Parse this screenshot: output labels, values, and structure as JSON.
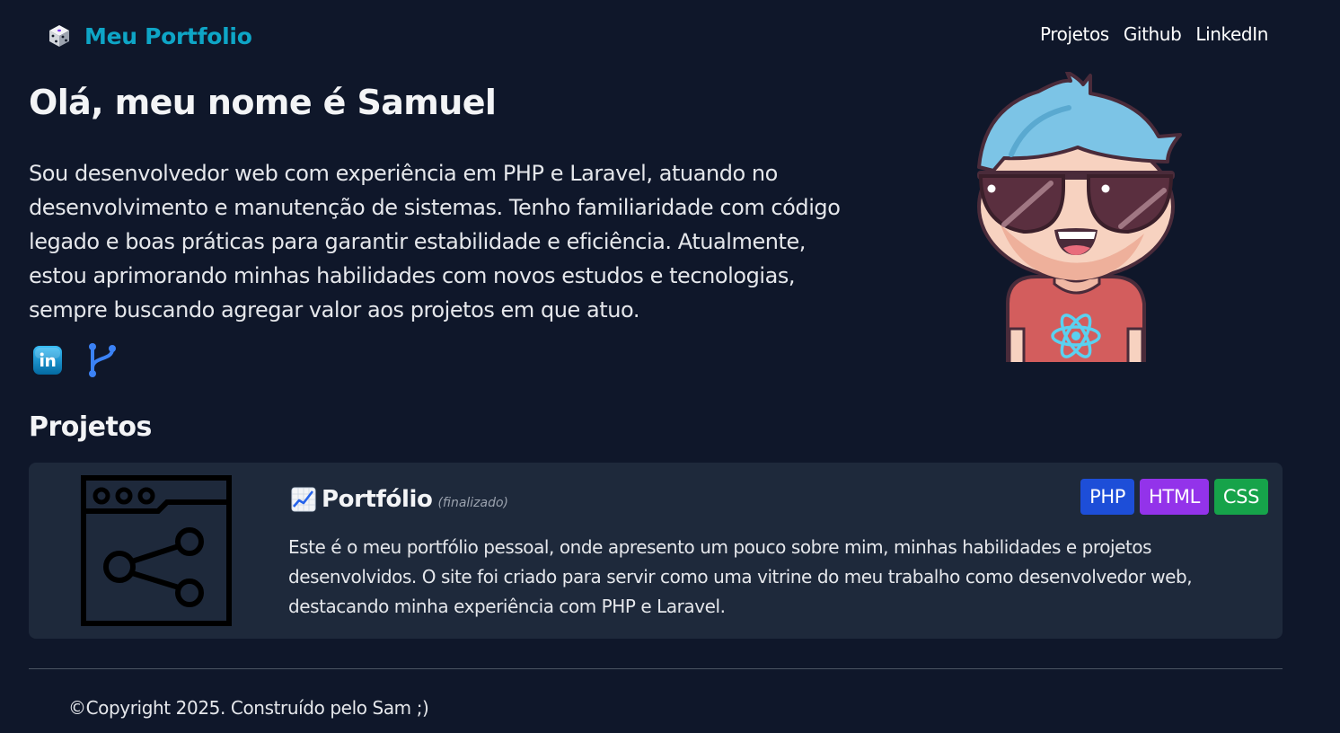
{
  "navbar": {
    "brand": "Meu Portfolio",
    "brand_icon": "dice-icon",
    "links": [
      "Projetos",
      "Github",
      "LinkedIn"
    ]
  },
  "hero": {
    "title": "Olá, meu nome é Samuel",
    "bio": "Sou desenvolvedor web com experiência em PHP e Laravel, atuando no desenvolvimento e manutenção de sistemas. Tenho familiaridade com código legado e boas práticas para garantir estabilidade e eficiência. Atualmente, estou aprimorando minhas habilidades com novos estudos e tecnologias, sempre buscando agregar valor aos projetos em que atuo.",
    "social_icons": [
      "linkedin-icon",
      "git-branch-icon"
    ],
    "avatar": "cartoon-avatar-illustration"
  },
  "projects": {
    "title": "Projetos",
    "items": [
      {
        "icon": "share-window-icon",
        "title_icon": "chart-emoji-icon",
        "name": "Portfólio",
        "status": "(finalizado)",
        "tags": [
          {
            "label": "PHP",
            "color": "#1d4ed8"
          },
          {
            "label": "HTML",
            "color": "#9333ea"
          },
          {
            "label": "CSS",
            "color": "#16a34a"
          }
        ],
        "description": "Este é o meu portfólio pessoal, onde apresento um pouco sobre mim, minhas habilidades e projetos desenvolvidos. O site foi criado para servir como uma vitrine do meu trabalho como desenvolvedor web, destacando minha experiência com PHP e Laravel."
      }
    ]
  },
  "footer": {
    "text": "©Copyright 2025. Construído pelo Sam ;)"
  },
  "colors": {
    "background": "#0f172a",
    "card": "#1e293b",
    "brand": "#0ea5c6"
  }
}
